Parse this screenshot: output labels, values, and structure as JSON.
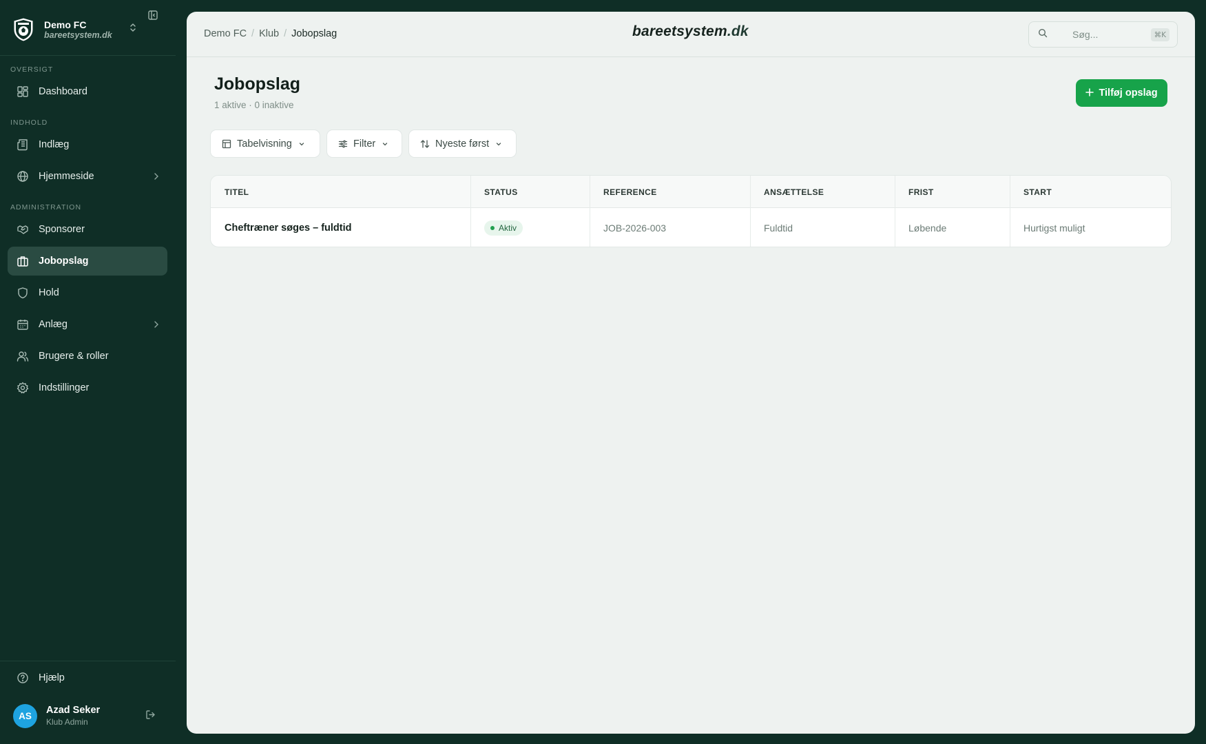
{
  "sidebar": {
    "club_name": "Demo FC",
    "club_domain": "bareetsystem.dk",
    "sections": {
      "overview": "OVERSIGT",
      "content": "INDHOLD",
      "administration": "ADMINISTRATION"
    },
    "items": [
      {
        "label": "Dashboard",
        "icon": "dashboard-icon"
      },
      {
        "label": "Indlæg",
        "icon": "newspaper-icon"
      },
      {
        "label": "Hjemmeside",
        "icon": "globe-icon",
        "has_submenu": true
      },
      {
        "label": "Sponsorer",
        "icon": "handshake-icon"
      },
      {
        "label": "Jobopslag",
        "icon": "briefcase-icon",
        "active": true
      },
      {
        "label": "Hold",
        "icon": "shield-icon"
      },
      {
        "label": "Anlæg",
        "icon": "calendar-icon",
        "has_submenu": true
      },
      {
        "label": "Brugere & roller",
        "icon": "users-icon"
      },
      {
        "label": "Indstillinger",
        "icon": "gear-icon"
      }
    ],
    "help_label": "Hjælp",
    "user": {
      "initials": "AS",
      "name": "Azad Seker",
      "role": "Klub Admin"
    }
  },
  "header": {
    "breadcrumb": [
      "Demo FC",
      "Klub",
      "Jobopslag"
    ],
    "breadcrumb_separator": "/",
    "brand_name": "bareetsystem",
    "brand_tld": ".dk",
    "search_placeholder": "Søg...",
    "search_shortcut": "⌘K"
  },
  "page": {
    "title": "Jobopslag",
    "subtitle": "1 aktive · 0 inaktive",
    "add_button_label": "Tilføj opslag"
  },
  "toolbar": {
    "view_label": "Tabelvisning",
    "filter_label": "Filter",
    "sort_label": "Nyeste først"
  },
  "table": {
    "columns": [
      "TITEL",
      "STATUS",
      "REFERENCE",
      "ANSÆTTELSE",
      "FRIST",
      "START"
    ],
    "rows": [
      {
        "title": "Cheftræner søges – fuldtid",
        "status": "Aktiv",
        "reference": "JOB-2026-003",
        "employment": "Fuldtid",
        "deadline": "Løbende",
        "start": "Hurtigst muligt"
      }
    ]
  },
  "colors": {
    "sidebar_bg": "#0f2e26",
    "active_nav_bg": "#2a4b42",
    "accent_green": "#17a34a",
    "avatar_blue": "#1ea3e0",
    "status_active": "#22a04f"
  }
}
